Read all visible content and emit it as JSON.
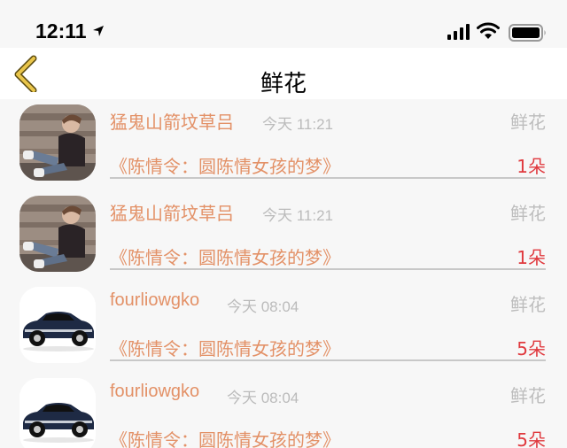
{
  "status_bar": {
    "time": "12:11"
  },
  "nav": {
    "title": "鲜花"
  },
  "rows": [
    {
      "name": "猛鬼山箭坟草吕",
      "time": "今天 11:21",
      "type": "鲜花",
      "book": "《陈情令：圆陈情女孩的梦》",
      "count": "1朵",
      "avatar": "person-photo"
    },
    {
      "name": "猛鬼山箭坟草吕",
      "time": "今天 11:21",
      "type": "鲜花",
      "book": "《陈情令：圆陈情女孩的梦》",
      "count": "1朵",
      "avatar": "person-photo"
    },
    {
      "name": "fourliowgko",
      "time": "今天 08:04",
      "type": "鲜花",
      "book": "《陈情令：圆陈情女孩的梦》",
      "count": "5朵",
      "avatar": "car-photo"
    },
    {
      "name": "fourliowgko",
      "time": "今天 08:04",
      "type": "鲜花",
      "book": "《陈情令：圆陈情女孩的梦》",
      "count": "5朵",
      "avatar": "car-photo"
    }
  ],
  "colors": {
    "accent": "#e39167",
    "count": "#e0393e",
    "muted": "#bbbbbb",
    "back": "#d9b23a"
  }
}
